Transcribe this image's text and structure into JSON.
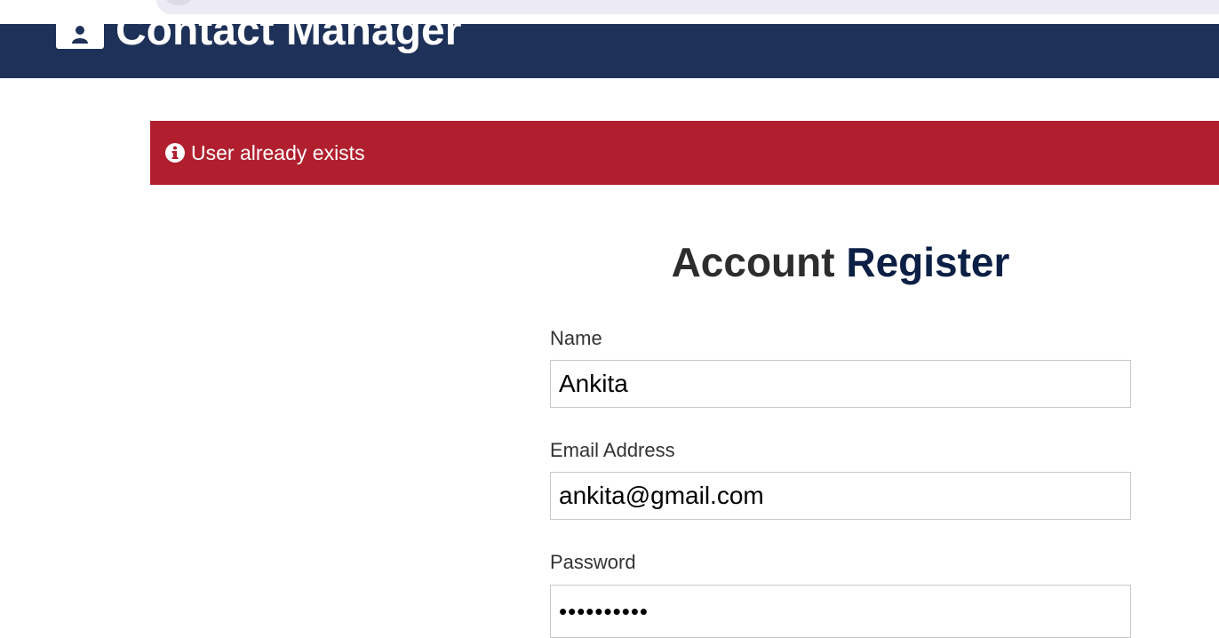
{
  "navbar": {
    "title": "Contact Manager",
    "icon": "user-id-icon",
    "background": "#1e3158"
  },
  "alert": {
    "message": "User already exists",
    "icon": "info-circle-icon",
    "background": "#b11f2e"
  },
  "heading": {
    "part1": "Account",
    "part2": "Register"
  },
  "form": {
    "name": {
      "label": "Name",
      "value": "Ankita"
    },
    "email": {
      "label": "Email Address",
      "value": "ankita@gmail.com"
    },
    "password": {
      "label": "Password",
      "value": "••••••••••"
    }
  }
}
